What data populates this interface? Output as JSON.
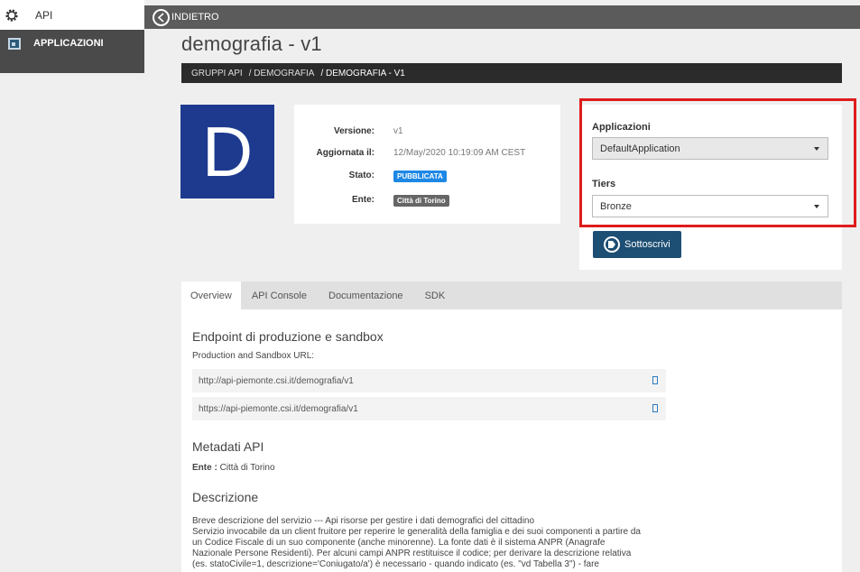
{
  "sidebar": {
    "api_label": "API",
    "app_label": "APPLICAZIONI"
  },
  "topbar": {
    "back_label": "INDIETRO"
  },
  "page": {
    "title": "demografia - v1"
  },
  "breadcrumb": [
    "GRUPPI API",
    "/ DEMOGRAFIA",
    "/ DEMOGRAFIA - V1"
  ],
  "logo": {
    "letter": "D",
    "color": "#1e3a8f"
  },
  "info": {
    "version_label": "Versione:",
    "version_value": "v1",
    "updated_label": "Aggiornata il:",
    "updated_value": "12/May/2020 10:19:09 AM CEST",
    "status_label": "Stato:",
    "status_value": "PUBBLICATA",
    "status_color": "#1e88e5",
    "ente_label": "Ente:",
    "ente_value": "Città di Torino",
    "ente_color": "#666666"
  },
  "subscribe": {
    "apps_label": "Applicazioni",
    "apps_selected": "DefaultApplication",
    "tiers_label": "Tiers",
    "tiers_selected": "Bronze",
    "button_label": "Sottoscrivi"
  },
  "tabs": [
    "Overview",
    "API Console",
    "Documentazione",
    "SDK"
  ],
  "overview": {
    "endpoint_title": "Endpoint di produzione e sandbox",
    "endpoint_sub": "Production and Sandbox URL:",
    "urls": [
      "http://api-piemonte.csi.it/demografia/v1",
      "https://api-piemonte.csi.it/demografia/v1"
    ],
    "metadata_title": "Metadati API",
    "ente_label": "Ente :",
    "ente_value": "Città di Torino",
    "desc_title": "Descrizione",
    "desc_lines": [
      "Breve descrizione del servizio --- Api risorse per gestire i dati demografici del cittadino",
      "Servizio invocabile da un client fruitore per reperire le generalità della famiglia e dei suoi componenti a partire da",
      "un Codice Fiscale di un suo componente (anche minorenne). La fonte dati è il sistema ANPR (Anagrafe",
      "Nazionale Persone Residenti). Per alcuni campi ANPR restituisce il codice; per derivare la descrizione relativa",
      "(es. statoCivile=1, descrizione='Coniugato/a') è necessario - quando indicato (es. \"vd Tabella 3\") - fare"
    ]
  }
}
